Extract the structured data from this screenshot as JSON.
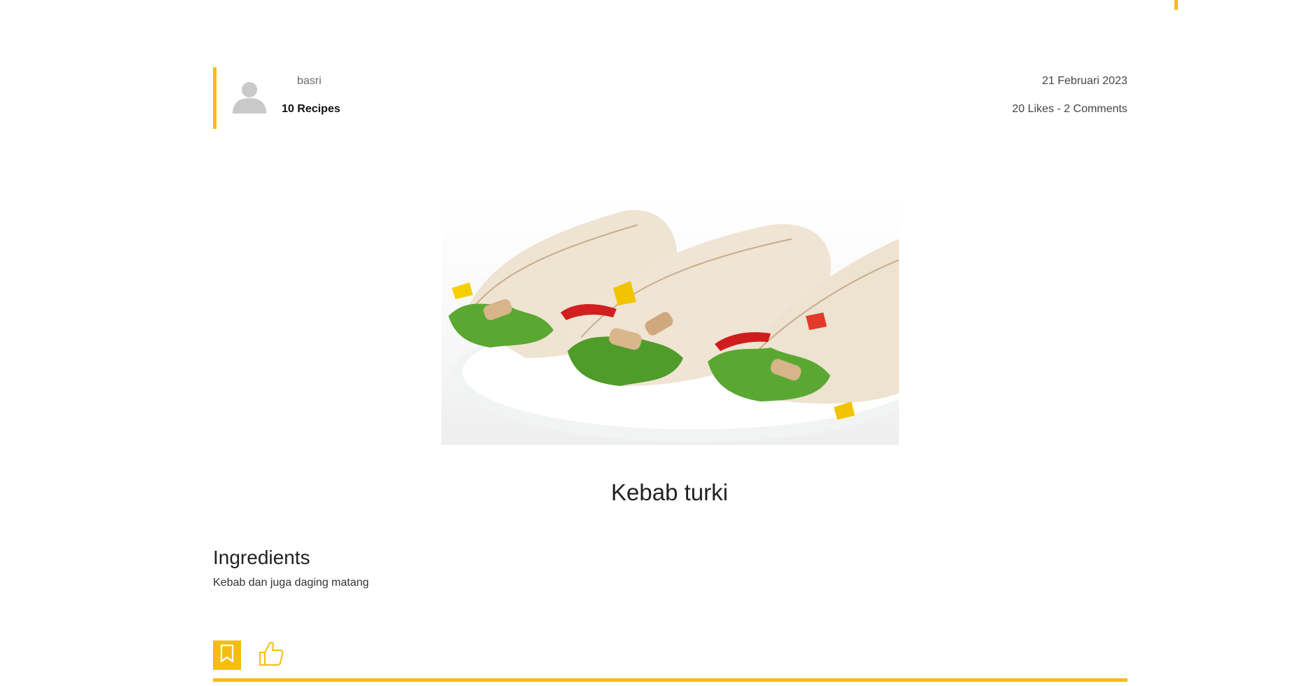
{
  "author": {
    "name": "basri",
    "recipes_count": "10 Recipes",
    "avatar_icon": "user-silhouette-icon"
  },
  "post": {
    "date": "21 Februari 2023",
    "stats": "20 Likes - 2 Comments"
  },
  "recipe": {
    "title": "Kebab turki",
    "image_alt": "Kebab turki"
  },
  "ingredients": {
    "heading": "Ingredients",
    "text": "Kebab dan juga daging matang"
  },
  "actions": {
    "save_icon": "bookmark-icon",
    "like_icon": "thumbs-up-icon"
  },
  "colors": {
    "accent": "#f5bd10",
    "avatar_gray": "#c9c9c9",
    "text_dark": "#222222",
    "text_muted": "#6b6b6b"
  }
}
